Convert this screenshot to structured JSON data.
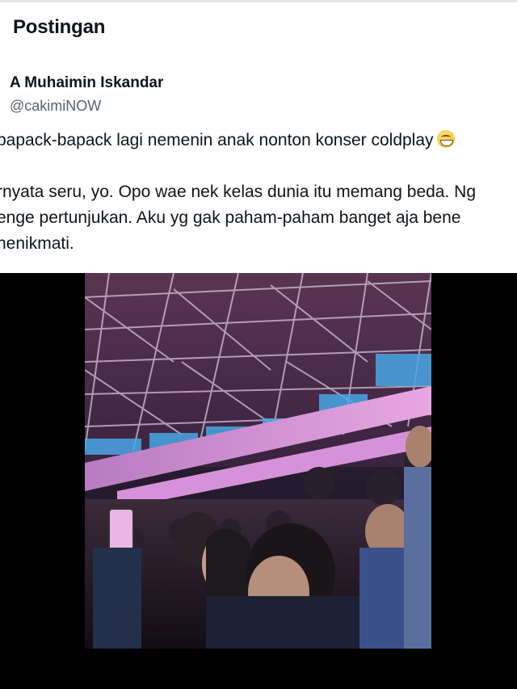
{
  "header": {
    "title": "Postingan"
  },
  "author": {
    "name": "A Muhaimin Iskandar",
    "handle": "@cakimiNOW"
  },
  "tweet": {
    "line1": "bapack-bapack lagi nemenin anak nonton konser coldplay",
    "emoji": "grinning-face-with-smiling-eyes",
    "line2": "rnyata seru, yo. Opo wae nek kelas dunia itu memang beda. Ng",
    "line3": "enge pertunjukan. Aku yg gak paham-paham banget aja bene",
    "line4": "nenikmati."
  },
  "media": {
    "type": "video",
    "description_icon": "concert-video"
  }
}
